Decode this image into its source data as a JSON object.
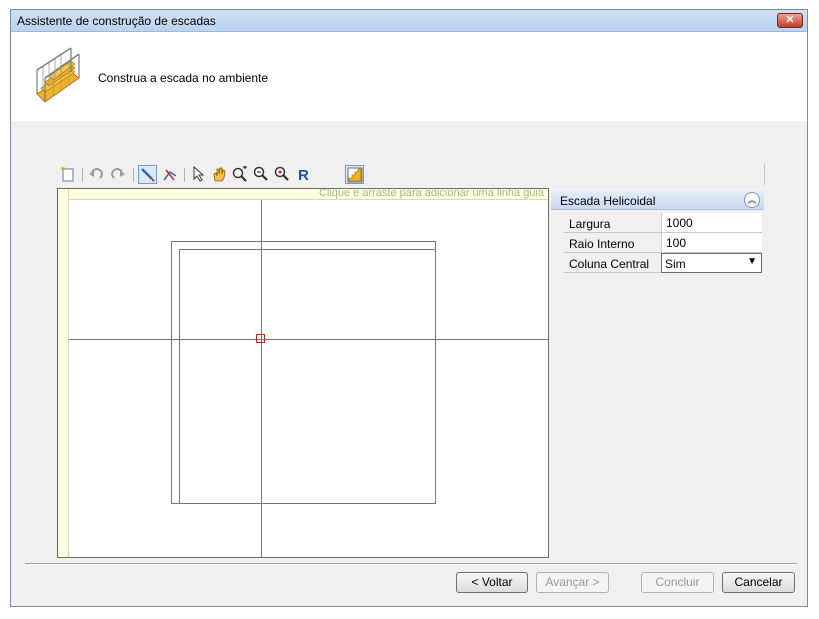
{
  "window": {
    "title": "Assistente de construção de escadas",
    "close_glyph": "✕"
  },
  "header": {
    "instruction": "Construa a escada no ambiente",
    "icon": "staircase-icon"
  },
  "toolbar": {
    "tools": [
      "new-icon",
      "undo-icon",
      "redo-icon",
      "draw-icon",
      "edit-path-icon",
      "select-arrow-icon",
      "pan-hand-icon",
      "zoom-window-icon",
      "zoom-in-icon",
      "zoom-out-icon",
      "redraw-icon",
      "staircase-view-icon"
    ]
  },
  "canvas": {
    "guide_hint": "Clique e arraste para adicionar uma linha guia"
  },
  "properties": {
    "section_title": "Escada Helicoidal",
    "rows": [
      {
        "label": "Largura",
        "value": "1000"
      },
      {
        "label": "Raio Interno",
        "value": "100"
      },
      {
        "label": "Coluna Central",
        "value": "Sim"
      }
    ]
  },
  "buttons": {
    "back": "< Voltar",
    "next": "Avançar >",
    "finish": "Concluir",
    "cancel": "Cancelar"
  },
  "colors": {
    "title_bar": "#bcd3ee",
    "accent": "#6f9bd8",
    "close": "#c43b25"
  }
}
